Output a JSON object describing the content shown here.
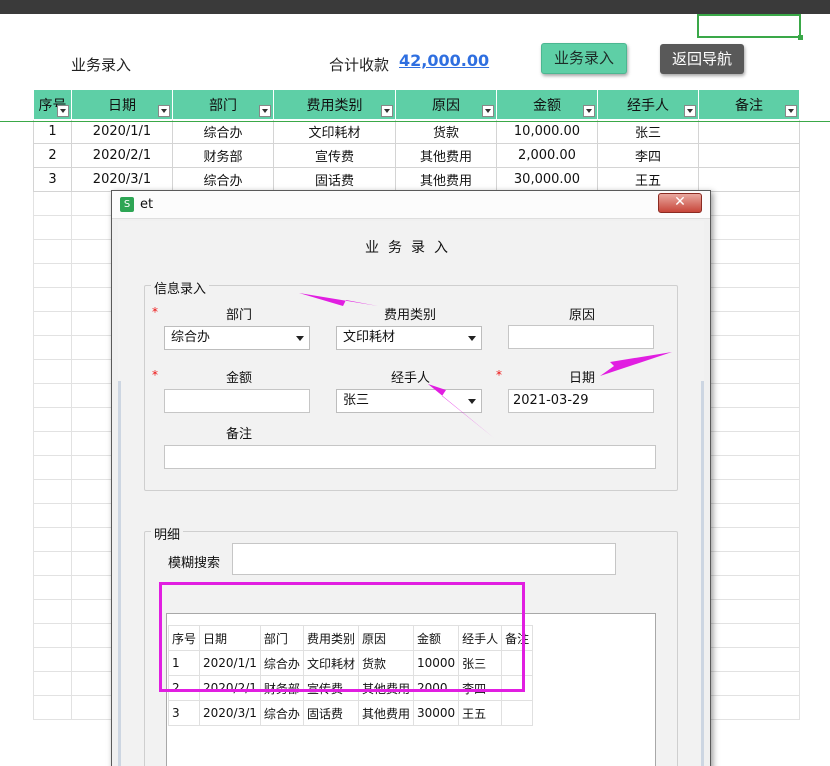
{
  "header": {
    "title": "业务录入",
    "total_label": "合计收款",
    "total_value": "42,000.00",
    "entry_button": "业务录入",
    "back_button": "返回导航"
  },
  "sheet": {
    "columns": [
      "序号",
      "日期",
      "部门",
      "费用类别",
      "原因",
      "金额",
      "经手人",
      "备注"
    ],
    "rows": [
      [
        "1",
        "2020/1/1",
        "综合办",
        "文印耗材",
        "货款",
        "10,000.00",
        "张三",
        ""
      ],
      [
        "2",
        "2020/2/1",
        "财务部",
        "宣传费",
        "其他费用",
        "2,000.00",
        "李四",
        ""
      ],
      [
        "3",
        "2020/3/1",
        "综合办",
        "固话费",
        "其他费用",
        "30,000.00",
        "王五",
        ""
      ]
    ]
  },
  "dialog": {
    "window_title": "et",
    "icon": "S",
    "close_icon": "✕",
    "heading": "业务录入",
    "info_group": "信息录入",
    "labels": {
      "dept": "部门",
      "category": "费用类别",
      "reason": "原因",
      "amount": "金额",
      "handler": "经手人",
      "date": "日期",
      "note": "备注"
    },
    "values": {
      "dept": "综合办",
      "category": "文印耗材",
      "reason": "",
      "amount": "",
      "handler": "张三",
      "date": "2021-03-29",
      "note": ""
    },
    "required_mark": "*",
    "detail_group": "明细",
    "search_label": "模糊搜索",
    "search_value": "",
    "grid_columns": [
      "序号",
      "日期",
      "部门",
      "费用类别",
      "原因",
      "金额",
      "经手人",
      "备注"
    ],
    "grid_rows": [
      [
        "1",
        "2020/1/1",
        "综合办",
        "文印耗材",
        "货款",
        "10000",
        "张三",
        ""
      ],
      [
        "2",
        "2020/2/1",
        "财务部",
        "宣传费",
        "其他费用",
        "2000",
        "李四",
        ""
      ],
      [
        "3",
        "2020/3/1",
        "综合办",
        "固话费",
        "其他费用",
        "30000",
        "王五",
        ""
      ]
    ]
  },
  "colors": {
    "header_green": "#5ecfa6",
    "link_blue": "#2f6fe0",
    "highlight_magenta": "#e11ee1",
    "required_red": "#ee1111"
  }
}
